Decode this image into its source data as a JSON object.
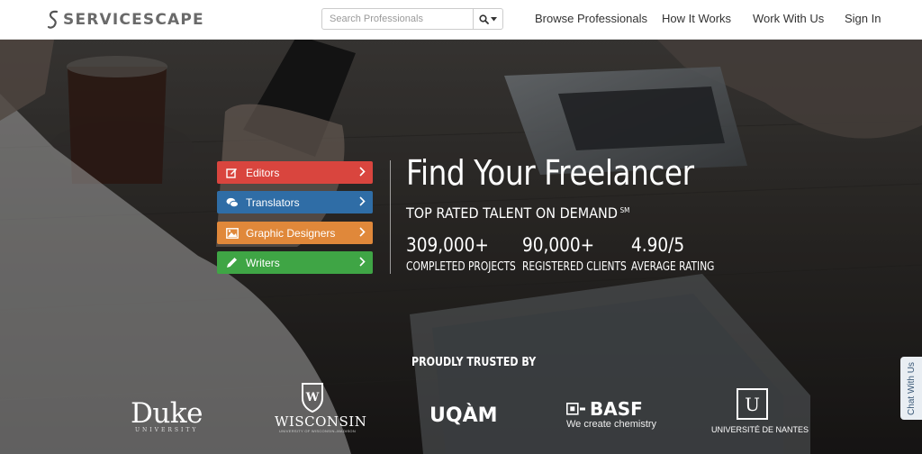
{
  "header": {
    "logo_text": "SERVICESCAPE",
    "search": {
      "placeholder": "Search Professionals"
    },
    "nav": [
      {
        "label": "Browse Professionals"
      },
      {
        "label": "How It Works"
      },
      {
        "label": "Work With Us"
      },
      {
        "label": "Sign In"
      }
    ]
  },
  "hero": {
    "categories": [
      {
        "label": "Editors",
        "icon": "edit-icon",
        "color": "#d9453e"
      },
      {
        "label": "Translators",
        "icon": "chat-icon",
        "color": "#2f6da6"
      },
      {
        "label": "Graphic Designers",
        "icon": "picture-icon",
        "color": "#e0883a"
      },
      {
        "label": "Writers",
        "icon": "pencil-icon",
        "color": "#3fa545"
      }
    ],
    "title": "Find Your Freelancer",
    "subtitle": "TOP RATED TALENT ON DEMAND",
    "subtitle_mark": "SM",
    "stats": [
      {
        "value": "309,000+",
        "label": "COMPLETED PROJECTS"
      },
      {
        "value": "90,000+",
        "label": "REGISTERED CLIENTS"
      },
      {
        "value": "4.90/5",
        "label": "AVERAGE RATING"
      }
    ],
    "trusted_heading": "PROUDLY TRUSTED BY",
    "clients": {
      "duke": {
        "name": "Duke",
        "sub": "UNIVERSITY"
      },
      "wisconsin": {
        "name": "WISCONSIN",
        "sub": "UNIVERSITY OF WISCONSIN–MADISON",
        "crest_letter": "W"
      },
      "uqam": {
        "name": "UQÀM"
      },
      "basf": {
        "name": "BASF",
        "sub": "We create chemistry"
      },
      "nantes": {
        "name": "UNIVERSITÉ DE NANTES",
        "mark": "U"
      }
    }
  },
  "chat_tab": {
    "label": "Chat With Us"
  }
}
